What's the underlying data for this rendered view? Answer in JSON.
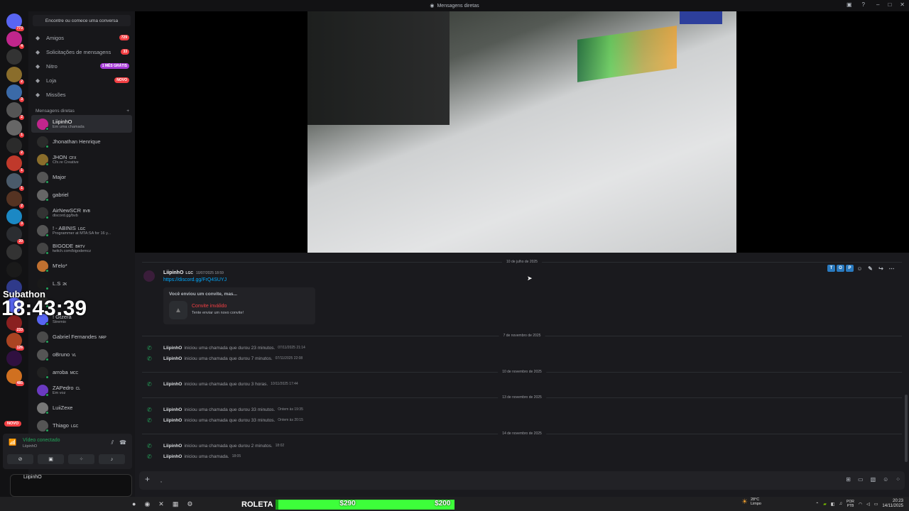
{
  "window": {
    "title": "Mensagens diretas"
  },
  "servers": [
    {
      "badge": "773"
    },
    {
      "badge": "4"
    },
    {
      "badge": ""
    },
    {
      "badge": "2"
    },
    {
      "badge": "3"
    },
    {
      "badge": "2"
    },
    {
      "badge": "1"
    },
    {
      "badge": "2"
    },
    {
      "badge": "1"
    },
    {
      "badge": "1"
    },
    {
      "badge": "2"
    },
    {
      "badge": "3"
    },
    {
      "badge": "20"
    },
    {
      "badge": ""
    },
    {
      "badge": ""
    },
    {
      "badge": ""
    },
    {
      "badge": ""
    },
    {
      "badge": "233"
    },
    {
      "badge": "126"
    },
    {
      "badge": ""
    },
    {
      "badge": "485"
    }
  ],
  "sidebar": {
    "search_placeholder": "Encontre ou comece uma conversa",
    "nav": [
      {
        "label": "Amigos",
        "badge": "729",
        "badge_color": "#f23f43",
        "icon": "friends-icon"
      },
      {
        "label": "Solicitações de mensagens",
        "badge": "33",
        "badge_color": "#f23f43",
        "icon": "mail-icon"
      },
      {
        "label": "Nitro",
        "badge": "1 MÊS GRÁTIS",
        "badge_color": "#a63bd6",
        "icon": "nitro-icon"
      },
      {
        "label": "Loja",
        "badge": "NOVO",
        "badge_color": "#f23f43",
        "icon": "shop-icon"
      },
      {
        "label": "Missões",
        "badge": "",
        "icon": "quest-icon"
      }
    ],
    "dm_header": "Mensagens diretas",
    "dm_add": "+",
    "dms": [
      {
        "name": "LiipinhO",
        "sub": "Em uma chamada",
        "tag": "",
        "active": true
      },
      {
        "name": "Jhonathan Henrique",
        "sub": "",
        "tag": ""
      },
      {
        "name": "JHON",
        "sub": "Cfx.re Creative",
        "tag": "CFX"
      },
      {
        "name": "Major",
        "sub": "",
        "tag": ""
      },
      {
        "name": "gabriel",
        "sub": "",
        "tag": ""
      },
      {
        "name": "AirNewSCR",
        "sub": "discord.gg/bvb",
        "tag": "BVB"
      },
      {
        "name": "! - ABINIS",
        "sub": "Programmer at MTA:SA for 16 y...",
        "tag": "LGC"
      },
      {
        "name": "BIGODE",
        "sub": "twitch.com/bigodemcz",
        "tag": "BRTV"
      },
      {
        "name": "M'elo*",
        "sub": "",
        "tag": ""
      },
      {
        "name": "L.S",
        "sub": "",
        "tag": "2K"
      },
      {
        "name": "",
        "sub": "",
        "tag": ""
      },
      {
        "name": "! Gtzera",
        "sub": "Stremio",
        "tag": ""
      },
      {
        "name": "Gabriel Fernandes",
        "sub": "",
        "tag": "NRP"
      },
      {
        "name": "oBruno",
        "sub": "",
        "tag": "VL"
      },
      {
        "name": "arroba",
        "sub": "",
        "tag": "MCC"
      },
      {
        "name": "ZAPedro",
        "sub": "Em voz",
        "tag": "CL"
      },
      {
        "name": "LuiiZexe",
        "sub": "",
        "tag": ""
      },
      {
        "name": "Thiago",
        "sub": "",
        "tag": "LGC"
      }
    ]
  },
  "overlay": {
    "subathon": "Subathon",
    "clock": "18:43:39"
  },
  "voice": {
    "title": "Vídeo conectado",
    "sub": "LiipinhO",
    "novo": "NOVO",
    "user": "LiipinhO"
  },
  "chat": {
    "date1": "10 de julho de 2025",
    "message": {
      "author": "LiipinhO",
      "tag": "LGC",
      "time": "10/07/2025 18:59",
      "link": "https://discord.gg/FrQ4SUYJ",
      "invite_header": "Você enviou um convite, mas...",
      "invite_title": "Convite inválido",
      "invite_sub": "Tente enviar um novo convite!"
    },
    "date2": "7 de novembro de 2025",
    "date3": "10 de novembro de 2025",
    "date4": "13 de novembro de 2025",
    "date5": "14 de novembro de 2025",
    "calls": [
      {
        "who": "LiipinhO",
        "text": "iniciou uma chamada que durou 23 minutos.",
        "time": "07/11/2025 21:14"
      },
      {
        "who": "LiipinhO",
        "text": "iniciou uma chamada que durou 7 minutos.",
        "time": "07/11/2025 22:08"
      },
      {
        "who": "LiipinhO",
        "text": "iniciou uma chamada que durou 3 horas.",
        "time": "10/11/2025 17:44"
      },
      {
        "who": "LiipinhO",
        "text": "iniciou uma chamada que durou 33 minutos.",
        "time": "Ontem às 19:35"
      },
      {
        "who": "LiipinhO",
        "text": "iniciou uma chamada que durou 33 minutos.",
        "time": "Ontem às 20:15"
      },
      {
        "who": "LiipinhO",
        "text": "iniciou uma chamada que durou 2 minutos.",
        "time": "18:02"
      },
      {
        "who": "LiipinhO",
        "text": "iniciou uma chamada.",
        "time": "18:05"
      }
    ],
    "toolbar_badges": [
      "T",
      "O",
      "P"
    ],
    "composer_value": ","
  },
  "taskbar": {
    "roleta_label": "ROLETA",
    "roleta_value1": "$290",
    "roleta_value2": "$200",
    "weather_temp": "28°C",
    "weather_desc": "Limpo",
    "lang_line1": "POR",
    "lang_line2": "PTB",
    "time": "20:23",
    "date": "14/11/2025"
  }
}
